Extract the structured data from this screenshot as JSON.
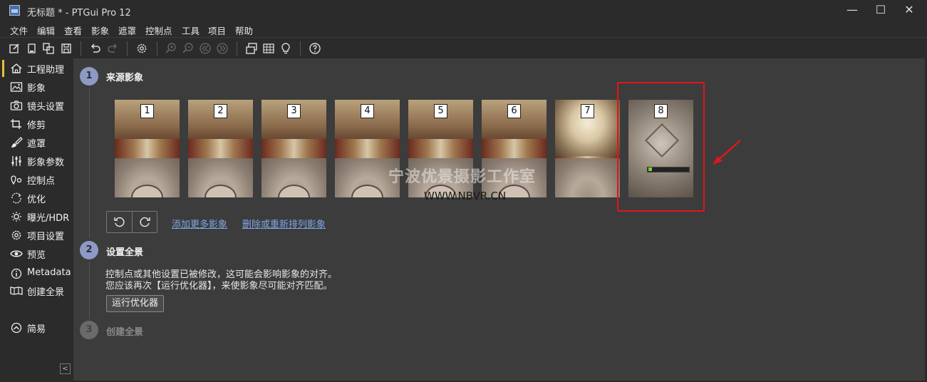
{
  "window": {
    "title": "无标题 * - PTGui Pro 12",
    "minimize_glyph": "—",
    "maximize_glyph": "☐",
    "close_glyph": "✕"
  },
  "menu": [
    "文件",
    "编辑",
    "查看",
    "影象",
    "遮罩",
    "控制点",
    "工具",
    "项目",
    "帮助"
  ],
  "toolbar_icons": [
    "new-project-icon",
    "open-icon",
    "copy-icon",
    "save-icon",
    "undo-icon",
    "redo-icon",
    "settings-icon",
    "zoom-in-icon",
    "zoom-out-icon",
    "first-icon",
    "last-icon",
    "panorama-editor-icon",
    "table-icon",
    "lightbulb-icon",
    "help-icon"
  ],
  "sidebar": {
    "items": [
      {
        "label": "工程助理",
        "icon": "home-icon",
        "active": true
      },
      {
        "label": "影象",
        "icon": "image-icon"
      },
      {
        "label": "镜头设置",
        "icon": "camera-icon"
      },
      {
        "label": "修剪",
        "icon": "crop-icon"
      },
      {
        "label": "遮罩",
        "icon": "brush-icon"
      },
      {
        "label": "影象参数",
        "icon": "sliders-icon"
      },
      {
        "label": "控制点",
        "icon": "control-points-icon"
      },
      {
        "label": "优化",
        "icon": "optimize-icon"
      },
      {
        "label": "曝光/HDR",
        "icon": "sun-icon"
      },
      {
        "label": "项目设置",
        "icon": "gear-icon"
      },
      {
        "label": "预览",
        "icon": "eye-icon"
      },
      {
        "label": "Metadata",
        "icon": "info-icon"
      },
      {
        "label": "创建全景",
        "icon": "panorama-icon"
      }
    ],
    "simple_mode": {
      "label": "简易",
      "icon": "chevron-up-circle-icon"
    },
    "collapse_glyph": "<"
  },
  "steps": [
    {
      "number": "1",
      "title": "来源影象"
    },
    {
      "number": "2",
      "title": "设置全景"
    },
    {
      "number": "3",
      "title": "创建全景"
    }
  ],
  "source_images": [
    {
      "number": "1"
    },
    {
      "number": "2"
    },
    {
      "number": "3"
    },
    {
      "number": "4"
    },
    {
      "number": "5"
    },
    {
      "number": "6"
    },
    {
      "number": "7"
    },
    {
      "number": "8"
    }
  ],
  "links": {
    "add_more": "添加更多影象",
    "remove_reorder": "删除或重新排列影象"
  },
  "setup_message": {
    "line1": "控制点或其他设置已被修改，这可能会影响影象的对齐。",
    "line2": "您应该再次【运行优化器】，来使影象尽可能对齐匹配。"
  },
  "run_optimizer_label": "运行优化器",
  "watermark": {
    "text": "宁波优景摄影工作室",
    "url": "WWW.NBVR.CN"
  },
  "colors": {
    "accent_active": "#e6c229",
    "step_circle": "#8e9ac4",
    "link": "#7fa6e8",
    "highlight": "#e0161b"
  }
}
